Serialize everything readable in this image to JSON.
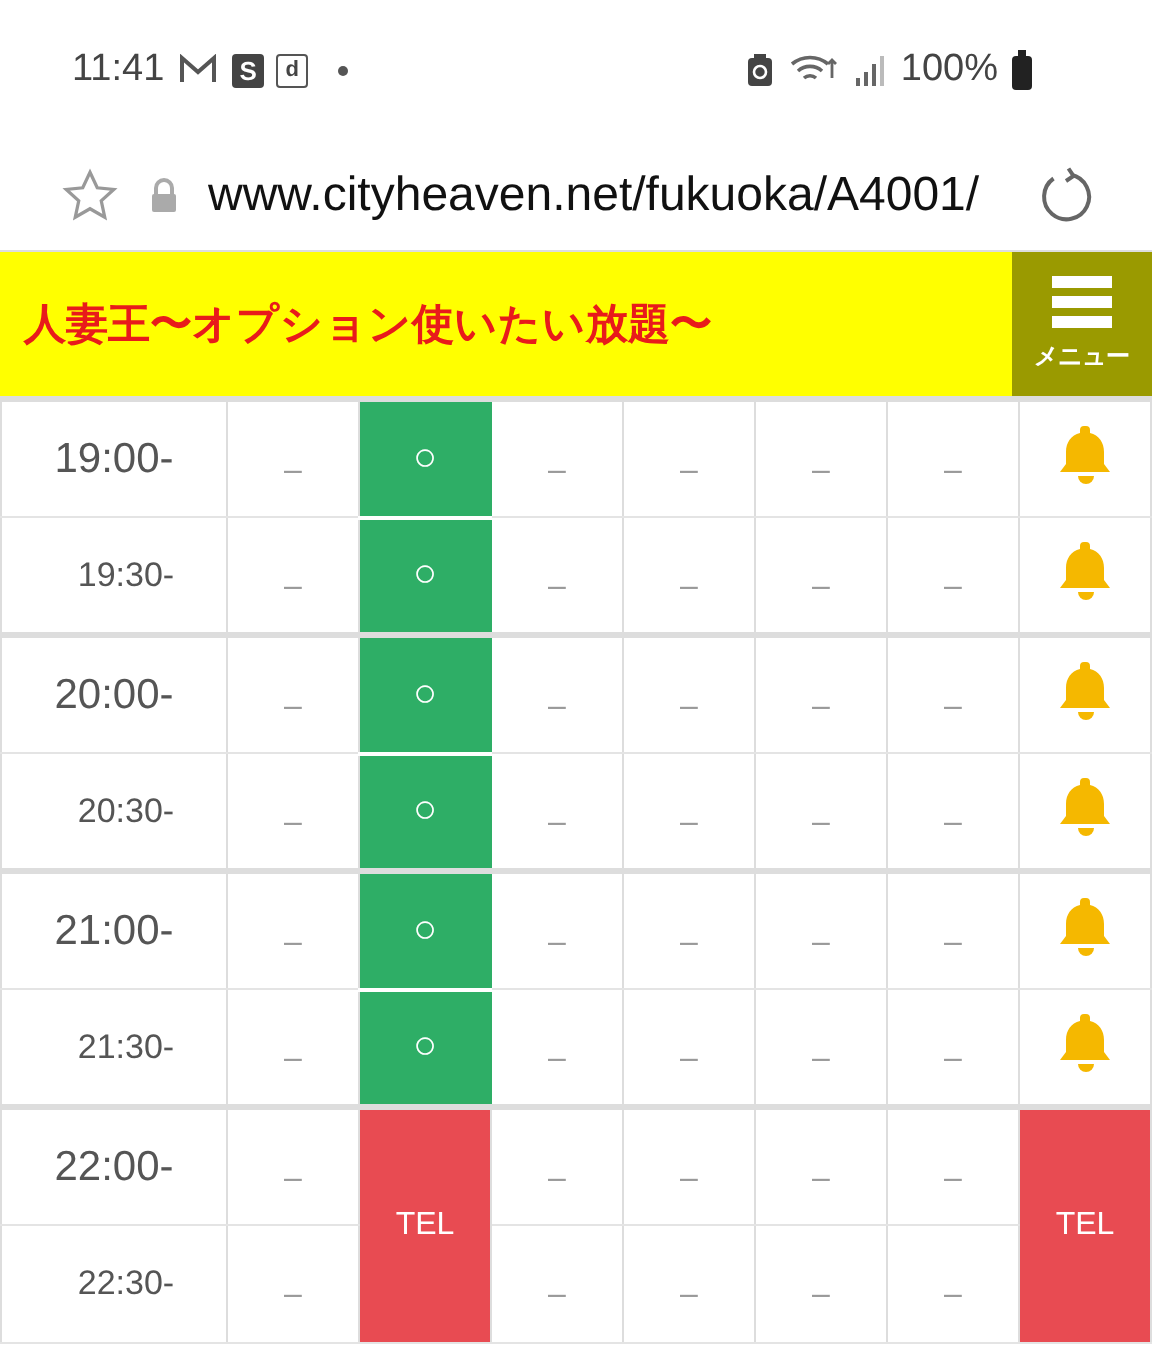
{
  "status_bar": {
    "time": "11:41",
    "badges": [
      "S",
      "d"
    ],
    "battery": "100%"
  },
  "address_bar": {
    "url": "www.cityheaven.net/fukuoka/A4001/"
  },
  "header": {
    "title": "人妻王〜オプション使いたい放題〜",
    "menu_label": "メニュー"
  },
  "schedule": {
    "rows": [
      {
        "time": "19:00-",
        "kind": "hour",
        "cells": [
          {
            "kind": "dash",
            "text": "–"
          },
          {
            "kind": "open",
            "text": "○"
          },
          {
            "kind": "dash",
            "text": "–"
          },
          {
            "kind": "dash",
            "text": "–"
          },
          {
            "kind": "dash",
            "text": "–"
          },
          {
            "kind": "dash",
            "text": "–"
          },
          {
            "kind": "bell"
          }
        ]
      },
      {
        "time": "19:30-",
        "kind": "half",
        "cells": [
          {
            "kind": "dash",
            "text": "–"
          },
          {
            "kind": "open",
            "text": "○"
          },
          {
            "kind": "dash",
            "text": "–"
          },
          {
            "kind": "dash",
            "text": "–"
          },
          {
            "kind": "dash",
            "text": "–"
          },
          {
            "kind": "dash",
            "text": "–"
          },
          {
            "kind": "bell"
          }
        ]
      },
      {
        "time": "20:00-",
        "kind": "hour",
        "cells": [
          {
            "kind": "dash",
            "text": "–"
          },
          {
            "kind": "open",
            "text": "○"
          },
          {
            "kind": "dash",
            "text": "–"
          },
          {
            "kind": "dash",
            "text": "–"
          },
          {
            "kind": "dash",
            "text": "–"
          },
          {
            "kind": "dash",
            "text": "–"
          },
          {
            "kind": "bell"
          }
        ]
      },
      {
        "time": "20:30-",
        "kind": "half",
        "cells": [
          {
            "kind": "dash",
            "text": "–"
          },
          {
            "kind": "open",
            "text": "○"
          },
          {
            "kind": "dash",
            "text": "–"
          },
          {
            "kind": "dash",
            "text": "–"
          },
          {
            "kind": "dash",
            "text": "–"
          },
          {
            "kind": "dash",
            "text": "–"
          },
          {
            "kind": "bell"
          }
        ]
      },
      {
        "time": "21:00-",
        "kind": "hour",
        "cells": [
          {
            "kind": "dash",
            "text": "–"
          },
          {
            "kind": "open",
            "text": "○"
          },
          {
            "kind": "dash",
            "text": "–"
          },
          {
            "kind": "dash",
            "text": "–"
          },
          {
            "kind": "dash",
            "text": "–"
          },
          {
            "kind": "dash",
            "text": "–"
          },
          {
            "kind": "bell"
          }
        ]
      },
      {
        "time": "21:30-",
        "kind": "half",
        "cells": [
          {
            "kind": "dash",
            "text": "–"
          },
          {
            "kind": "open",
            "text": "○"
          },
          {
            "kind": "dash",
            "text": "–"
          },
          {
            "kind": "dash",
            "text": "–"
          },
          {
            "kind": "dash",
            "text": "–"
          },
          {
            "kind": "dash",
            "text": "–"
          },
          {
            "kind": "bell"
          }
        ]
      },
      {
        "time": "22:00-",
        "kind": "hour",
        "cells": [
          {
            "kind": "dash",
            "text": "–"
          },
          {
            "kind": "tel",
            "text": "TEL",
            "rowspan": 2
          },
          {
            "kind": "dash",
            "text": "–"
          },
          {
            "kind": "dash",
            "text": "–"
          },
          {
            "kind": "dash",
            "text": "–"
          },
          {
            "kind": "dash",
            "text": "–"
          },
          {
            "kind": "tel",
            "text": "TEL",
            "rowspan": 2
          }
        ]
      },
      {
        "time": "22:30-",
        "kind": "half",
        "cells": [
          {
            "kind": "dash",
            "text": "–"
          },
          {
            "kind": "dash",
            "text": "–"
          },
          {
            "kind": "dash",
            "text": "–"
          },
          {
            "kind": "dash",
            "text": "–"
          },
          {
            "kind": "dash",
            "text": "–"
          }
        ]
      }
    ]
  }
}
